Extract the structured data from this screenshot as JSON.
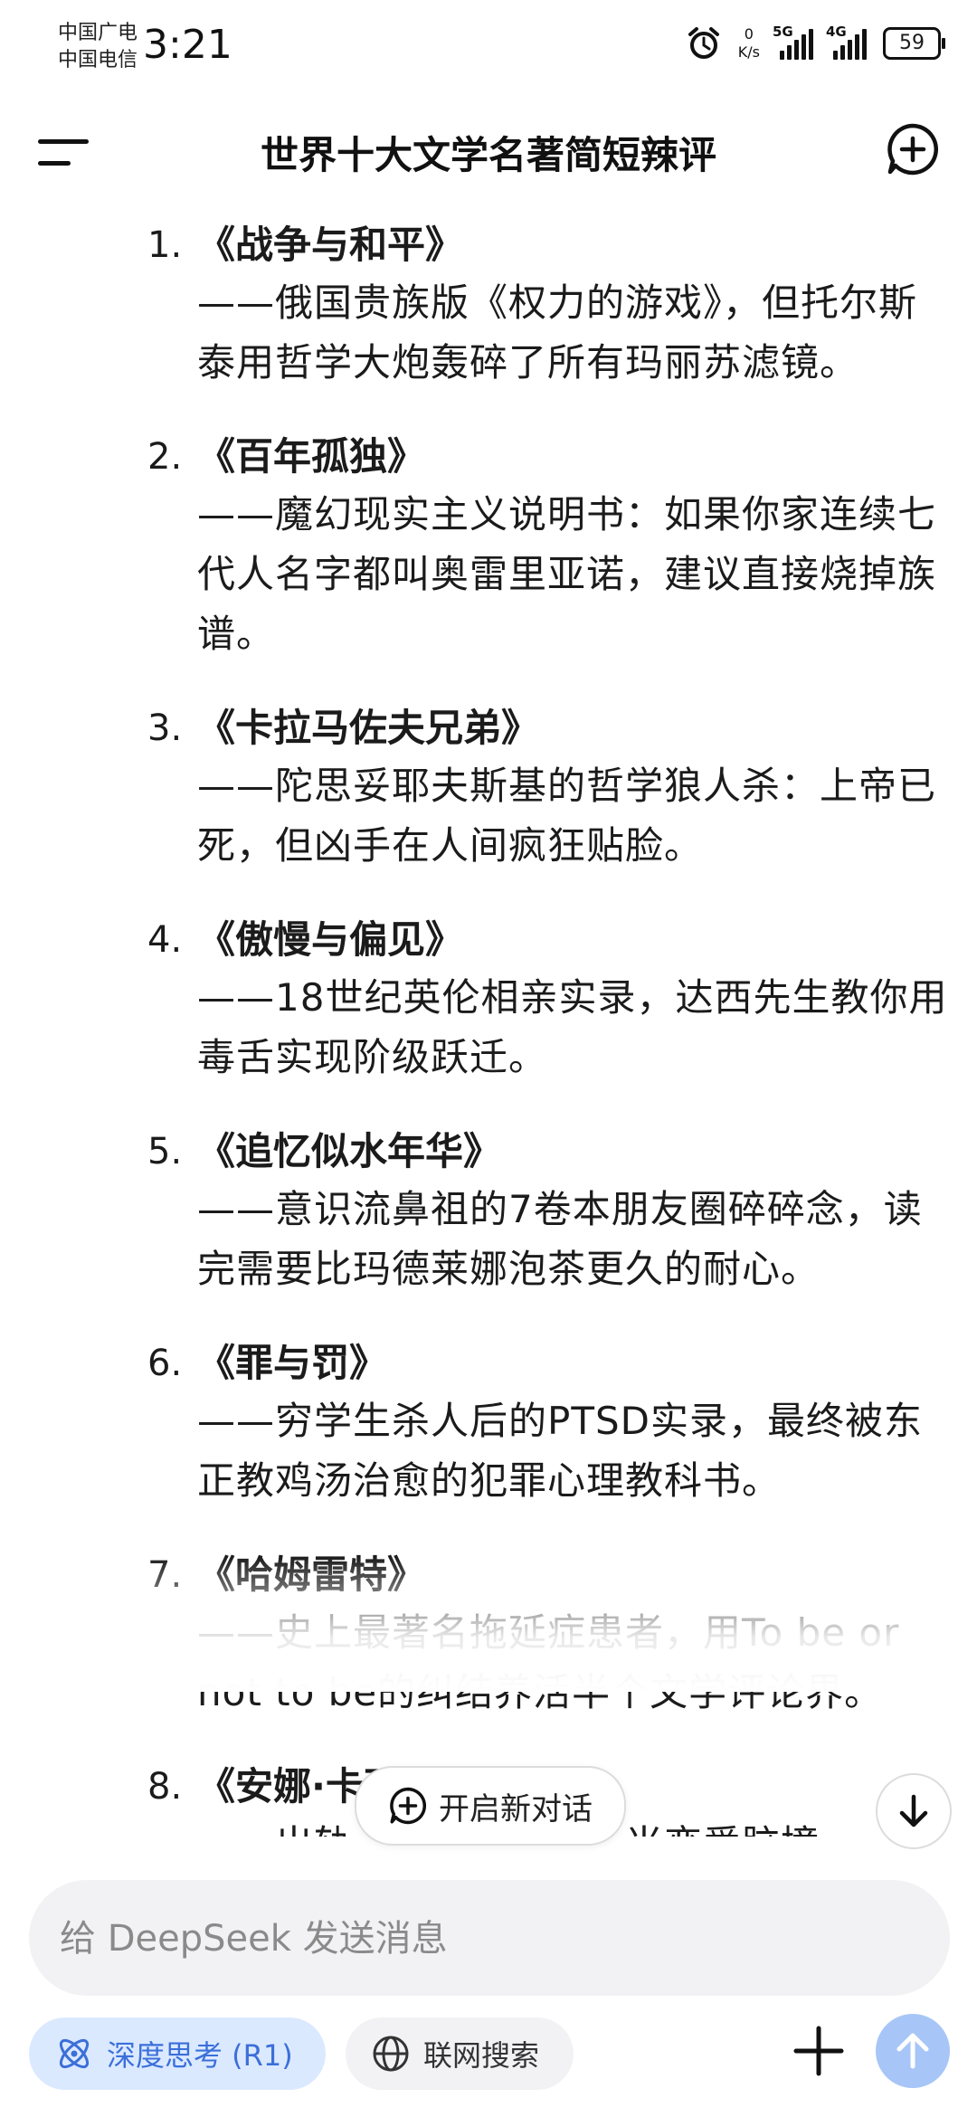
{
  "status_bar": {
    "carrier_1": "中国广电",
    "carrier_2": "中国电信",
    "time": "3:21",
    "net_speed_value": "0",
    "net_speed_unit": "K/s",
    "signal_1": "5G",
    "signal_2": "4G",
    "battery": "59"
  },
  "header": {
    "title": "世界十大文学名著简短辣评"
  },
  "items": [
    {
      "number": "1.",
      "title": "《战争与和平》",
      "desc": "——俄国贵族版《权力的游戏》，但托尔斯泰用哲学大炮轰碎了所有玛丽苏滤镜。"
    },
    {
      "number": "2.",
      "title": "《百年孤独》",
      "desc": "——魔幻现实主义说明书：如果你家连续七代人名字都叫奥雷里亚诺，建议直接烧掉族谱。"
    },
    {
      "number": "3.",
      "title": "《卡拉马佐夫兄弟》",
      "desc": "——陀思妥耶夫斯基的哲学狼人杀：上帝已死，但凶手在人间疯狂贴脸。"
    },
    {
      "number": "4.",
      "title": "《傲慢与偏见》",
      "desc": "——18世纪英伦相亲实录，达西先生教你用毒舌实现阶级跃迁。"
    },
    {
      "number": "5.",
      "title": "《追忆似水年华》",
      "desc": "——意识流鼻祖的7卷本朋友圈碎碎念，读完需要比玛德莱娜泡茶更久的耐心。"
    },
    {
      "number": "6.",
      "title": "《罪与罚》",
      "desc": "——穷学生杀人后的PTSD实录，最终被东正教鸡汤治愈的犯罪心理教科书。"
    },
    {
      "number": "7.",
      "title": "《哈姆雷特》",
      "desc": "——史上最著名拖延症患者，用To be or not to be的纠结养活半个文学评论界。"
    },
    {
      "number": "8.",
      "title": "《安娜·卡列尼娜》",
      "desc": "——出轨　　　　　　：当恋爱脑撞"
    }
  ],
  "new_chat_label": "开启新对话",
  "composer": {
    "placeholder": "给 DeepSeek 发送消息"
  },
  "toolbar": {
    "deep_think_label": "深度思考 (R1)",
    "web_search_label": "联网搜索"
  },
  "colors": {
    "accent": "#3b6fd9",
    "accent_bg": "#dbe9ff",
    "send_button": "#a7c6f7"
  },
  "icons": {
    "menu": "menu-icon",
    "new_chat": "new-chat-icon",
    "scroll_down": "arrow-down-icon",
    "deep_think": "atom-icon",
    "web_search": "globe-icon",
    "attach": "plus-icon",
    "send": "arrow-up-icon"
  }
}
